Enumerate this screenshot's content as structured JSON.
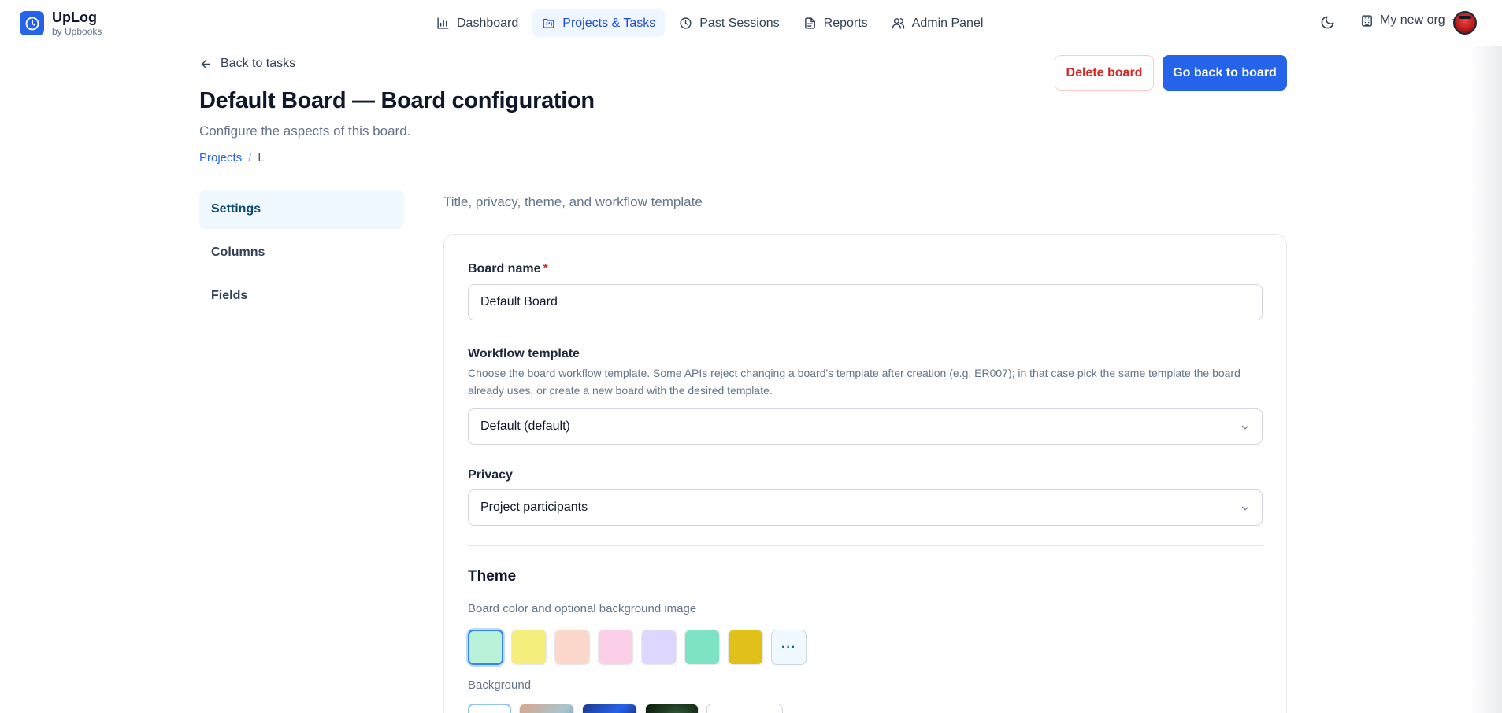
{
  "brand": {
    "name": "UpLog",
    "sub": "by Upbooks"
  },
  "nav": {
    "items": [
      {
        "label": "Dashboard",
        "icon": "bar-chart-icon",
        "active": false
      },
      {
        "label": "Projects & Tasks",
        "icon": "folder-kanban-icon",
        "active": true
      },
      {
        "label": "Past Sessions",
        "icon": "clock-icon",
        "active": false
      },
      {
        "label": "Reports",
        "icon": "file-text-icon",
        "active": false
      },
      {
        "label": "Admin Panel",
        "icon": "users-icon",
        "active": false
      }
    ]
  },
  "topright": {
    "org_label": "My new org"
  },
  "header": {
    "back_label": "Back to tasks",
    "title": "Default Board — Board configuration",
    "subtitle": "Configure the aspects of this board.",
    "breadcrumb": {
      "root": "Projects",
      "separator": "/",
      "current": "L"
    },
    "delete_label": "Delete board",
    "primary_label": "Go back to board"
  },
  "sidemenu": {
    "items": [
      {
        "label": "Settings",
        "active": true
      },
      {
        "label": "Columns",
        "active": false
      },
      {
        "label": "Fields",
        "active": false
      }
    ]
  },
  "settings": {
    "caption": "Title, privacy, theme, and workflow template",
    "board_name": {
      "label": "Board name",
      "required_mark": "*",
      "value": "Default Board"
    },
    "workflow": {
      "label": "Workflow template",
      "help": "Choose the board workflow template. Some APIs reject changing a board's template after creation (e.g. ER007); in that case pick the same template the board already uses, or create a new board with the desired template.",
      "value": "Default (default)"
    },
    "privacy": {
      "label": "Privacy",
      "value": "Project participants"
    },
    "theme": {
      "title": "Theme",
      "subtitle": "Board color and optional background image",
      "swatches": [
        "#b9f2d9",
        "#f5ee7c",
        "#fcd8cc",
        "#fbcfe8",
        "#ddd6fe",
        "#7ee3c4",
        "#e2c01a"
      ],
      "selected_swatch": 0,
      "more_label": "···",
      "background_label": "Background"
    }
  }
}
